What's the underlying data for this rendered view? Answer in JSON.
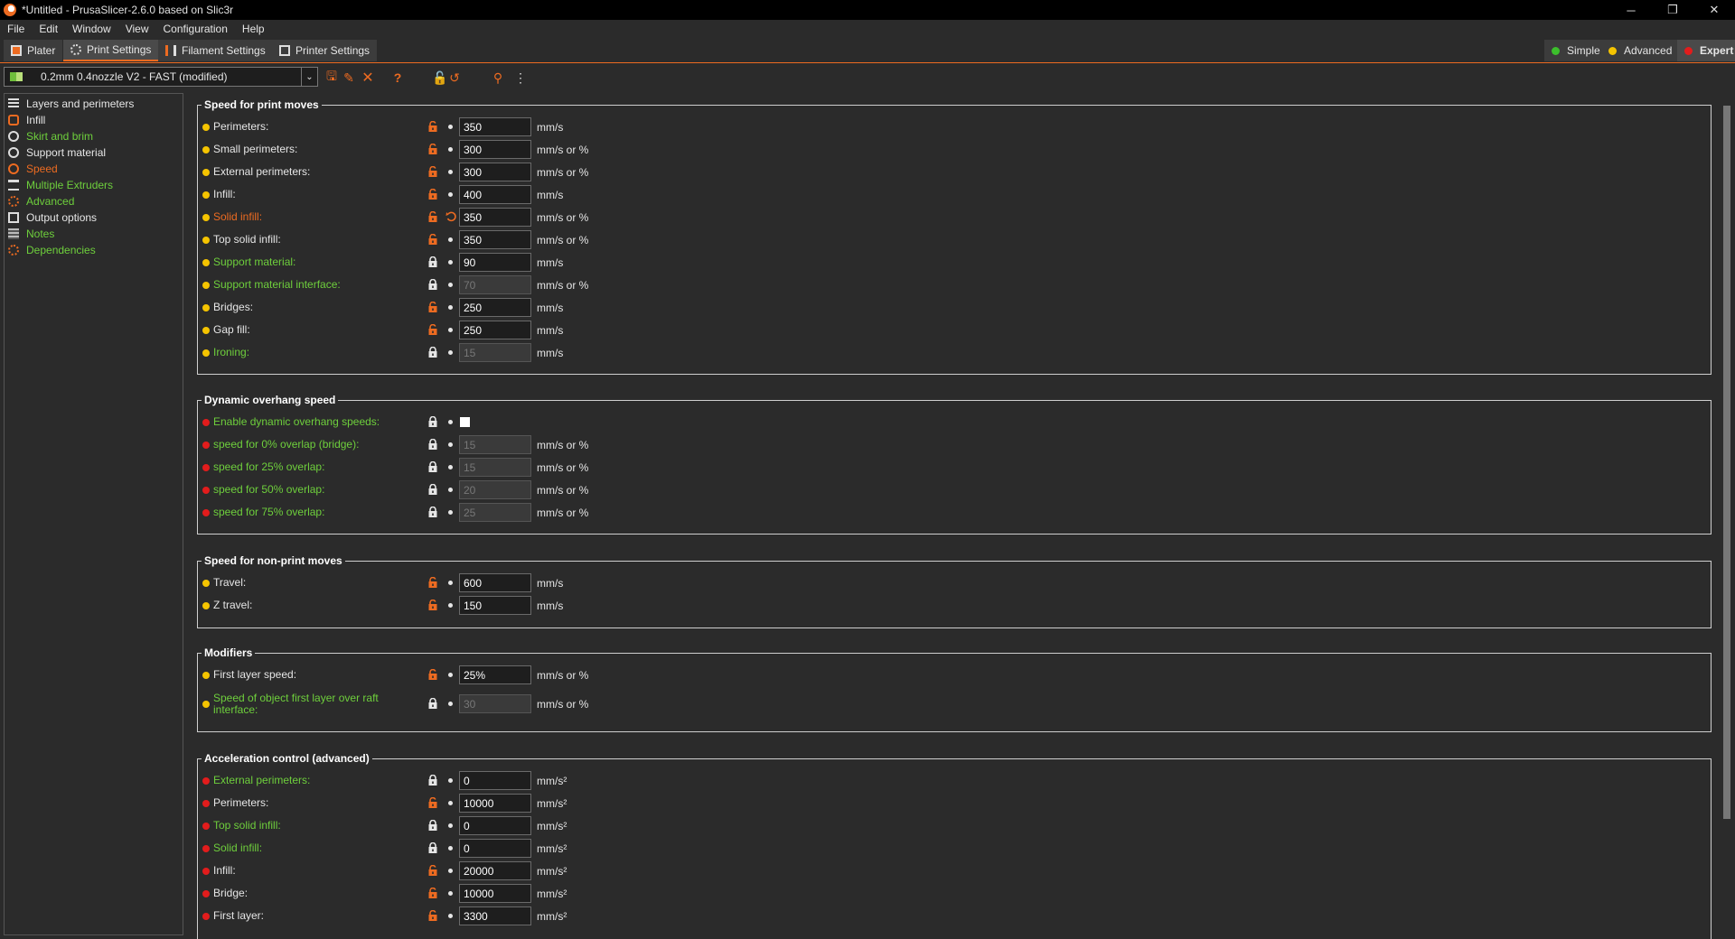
{
  "window": {
    "title": "*Untitled - PrusaSlicer-2.6.0 based on Slic3r",
    "controls": [
      "─",
      "❐",
      "✕"
    ]
  },
  "menu": [
    "File",
    "Edit",
    "Window",
    "View",
    "Configuration",
    "Help"
  ],
  "tabs": [
    {
      "label": "Plater",
      "icon": "plater-icon"
    },
    {
      "label": "Print Settings",
      "icon": "print-settings-icon",
      "active": true
    },
    {
      "label": "Filament Settings",
      "icon": "filament-icon"
    },
    {
      "label": "Printer Settings",
      "icon": "printer-icon"
    }
  ],
  "modes": [
    {
      "label": "Simple",
      "color": "#3cbf2c"
    },
    {
      "label": "Advanced",
      "color": "#f5c400"
    },
    {
      "label": "Expert",
      "color": "#e21c1c"
    }
  ],
  "preset": {
    "name": "0.2mm 0.4nozzle V2 - FAST (modified)",
    "caret": "⌄"
  },
  "toolbar_glyphs": {
    "save": "🖫",
    "edit": "✎",
    "delete": "✕",
    "help": "?",
    "lock_undo": "🔓",
    "reset": "↺",
    "search": "⚲",
    "compare": "⋮"
  },
  "sidebar": [
    {
      "label": "Layers and perimeters",
      "color": "#e6e6e6"
    },
    {
      "label": "Infill",
      "color": "#e6e6e6"
    },
    {
      "label": "Skirt and brim",
      "color": "#6ecf3c"
    },
    {
      "label": "Support material",
      "color": "#e6e6e6"
    },
    {
      "label": "Speed",
      "color": "#ed6b21"
    },
    {
      "label": "Multiple Extruders",
      "color": "#6ecf3c"
    },
    {
      "label": "Advanced",
      "color": "#6ecf3c"
    },
    {
      "label": "Output options",
      "color": "#e6e6e6"
    },
    {
      "label": "Notes",
      "color": "#6ecf3c"
    },
    {
      "label": "Dependencies",
      "color": "#6ecf3c"
    }
  ],
  "groups": {
    "print_moves": {
      "title": "Speed for print moves",
      "rows": [
        {
          "label": "Perimeters:",
          "value": "350",
          "unit": "mm/s",
          "dot": "#f5c400",
          "labelColor": "#e6e6e6",
          "locked": false
        },
        {
          "label": "Small perimeters:",
          "value": "300",
          "unit": "mm/s or %",
          "dot": "#f5c400",
          "labelColor": "#e6e6e6",
          "locked": false
        },
        {
          "label": "External perimeters:",
          "value": "300",
          "unit": "mm/s or %",
          "dot": "#f5c400",
          "labelColor": "#e6e6e6",
          "locked": false
        },
        {
          "label": "Infill:",
          "value": "400",
          "unit": "mm/s",
          "dot": "#f5c400",
          "labelColor": "#e6e6e6",
          "locked": false
        },
        {
          "label": "Solid infill:",
          "value": "350",
          "unit": "mm/s or %",
          "dot": "#f5c400",
          "labelColor": "#ed6b21",
          "locked": false,
          "modified": true
        },
        {
          "label": "Top solid infill:",
          "value": "350",
          "unit": "mm/s or %",
          "dot": "#f5c400",
          "labelColor": "#e6e6e6",
          "locked": false
        },
        {
          "label": "Support material:",
          "value": "90",
          "unit": "mm/s",
          "dot": "#f5c400",
          "labelColor": "#6ecf3c",
          "locked": true
        },
        {
          "label": "Support material interface:",
          "value": "70",
          "unit": "mm/s or %",
          "dot": "#f5c400",
          "labelColor": "#6ecf3c",
          "locked": true,
          "disabled": true
        },
        {
          "label": "Bridges:",
          "value": "250",
          "unit": "mm/s",
          "dot": "#f5c400",
          "labelColor": "#e6e6e6",
          "locked": false
        },
        {
          "label": "Gap fill:",
          "value": "250",
          "unit": "mm/s",
          "dot": "#f5c400",
          "labelColor": "#e6e6e6",
          "locked": false
        },
        {
          "label": "Ironing:",
          "value": "15",
          "unit": "mm/s",
          "dot": "#f5c400",
          "labelColor": "#6ecf3c",
          "locked": true,
          "disabled": true
        }
      ]
    },
    "overhang": {
      "title": "Dynamic overhang speed",
      "rows": [
        {
          "label": "Enable dynamic overhang speeds:",
          "checkbox": true,
          "unit": "",
          "dot": "#e21c1c",
          "labelColor": "#6ecf3c",
          "locked": true
        },
        {
          "label": "speed for 0% overlap (bridge):",
          "value": "15",
          "unit": "mm/s or %",
          "dot": "#e21c1c",
          "labelColor": "#6ecf3c",
          "locked": true,
          "disabled": true
        },
        {
          "label": "speed for 25% overlap:",
          "value": "15",
          "unit": "mm/s or %",
          "dot": "#e21c1c",
          "labelColor": "#6ecf3c",
          "locked": true,
          "disabled": true
        },
        {
          "label": "speed for 50% overlap:",
          "value": "20",
          "unit": "mm/s or %",
          "dot": "#e21c1c",
          "labelColor": "#6ecf3c",
          "locked": true,
          "disabled": true
        },
        {
          "label": "speed for 75% overlap:",
          "value": "25",
          "unit": "mm/s or %",
          "dot": "#e21c1c",
          "labelColor": "#6ecf3c",
          "locked": true,
          "disabled": true
        }
      ]
    },
    "non_print": {
      "title": "Speed for non-print moves",
      "rows": [
        {
          "label": "Travel:",
          "value": "600",
          "unit": "mm/s",
          "dot": "#f5c400",
          "labelColor": "#e6e6e6",
          "locked": false
        },
        {
          "label": "Z travel:",
          "value": "150",
          "unit": "mm/s",
          "dot": "#f5c400",
          "labelColor": "#e6e6e6",
          "locked": false
        }
      ]
    },
    "modifiers": {
      "title": "Modifiers",
      "rows": [
        {
          "label": "First layer speed:",
          "value": "25%",
          "unit": "mm/s or %",
          "dot": "#f5c400",
          "labelColor": "#e6e6e6",
          "locked": false
        },
        {
          "label": "Speed of object first layer over raft interface:",
          "value": "30",
          "unit": "mm/s or %",
          "dot": "#f5c400",
          "labelColor": "#6ecf3c",
          "locked": true,
          "disabled": true
        }
      ]
    },
    "accel": {
      "title": "Acceleration control (advanced)",
      "rows": [
        {
          "label": "External perimeters:",
          "value": "0",
          "unit": "mm/s²",
          "dot": "#e21c1c",
          "labelColor": "#6ecf3c",
          "locked": true
        },
        {
          "label": "Perimeters:",
          "value": "10000",
          "unit": "mm/s²",
          "dot": "#e21c1c",
          "labelColor": "#e6e6e6",
          "locked": false
        },
        {
          "label": "Top solid infill:",
          "value": "0",
          "unit": "mm/s²",
          "dot": "#e21c1c",
          "labelColor": "#6ecf3c",
          "locked": true
        },
        {
          "label": "Solid infill:",
          "value": "0",
          "unit": "mm/s²",
          "dot": "#e21c1c",
          "labelColor": "#6ecf3c",
          "locked": true
        },
        {
          "label": "Infill:",
          "value": "20000",
          "unit": "mm/s²",
          "dot": "#e21c1c",
          "labelColor": "#e6e6e6",
          "locked": false
        },
        {
          "label": "Bridge:",
          "value": "10000",
          "unit": "mm/s²",
          "dot": "#e21c1c",
          "labelColor": "#e6e6e6",
          "locked": false
        },
        {
          "label": "First layer:",
          "value": "3300",
          "unit": "mm/s²",
          "dot": "#e21c1c",
          "labelColor": "#e6e6e6",
          "locked": false
        }
      ]
    }
  }
}
